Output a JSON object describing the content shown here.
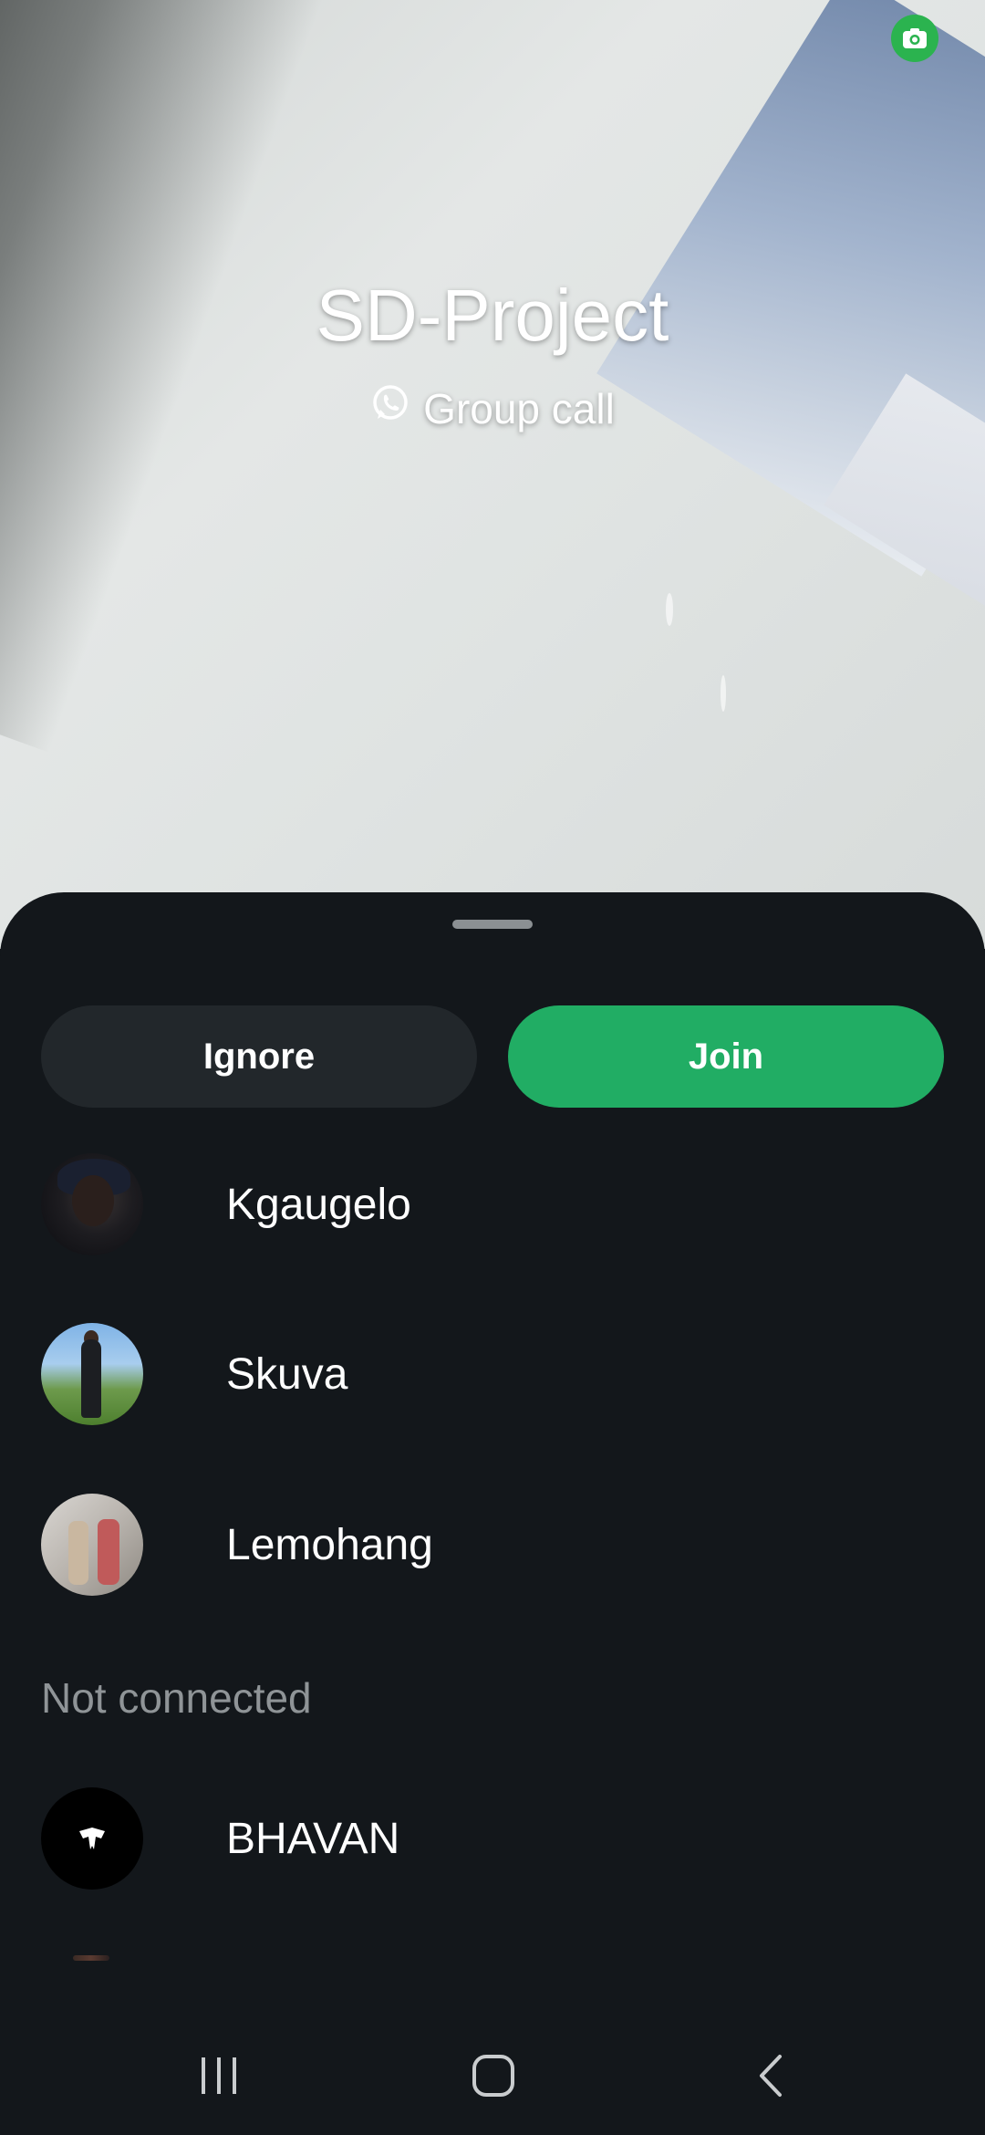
{
  "call": {
    "title": "SD-Project",
    "subtitle": "Group call",
    "subtitle_icon": "whatsapp-icon",
    "camera_icon": "camera-icon"
  },
  "actions": {
    "ignore_label": "Ignore",
    "join_label": "Join"
  },
  "participants": [
    {
      "name": "Kgaugelo",
      "avatar": "photo"
    },
    {
      "name": "Skuva",
      "avatar": "photo"
    },
    {
      "name": "Lemohang",
      "avatar": "photo"
    }
  ],
  "not_connected": {
    "label": "Not connected",
    "participants": [
      {
        "name": "BHAVAN",
        "avatar": "logo"
      }
    ]
  },
  "navbar": {
    "recents_icon": "recents-icon",
    "home_icon": "home-icon",
    "back_icon": "back-icon"
  },
  "colors": {
    "sheet_bg": "#13171b",
    "join_green": "#21ad64",
    "ignore_bg": "#22272b",
    "camera_badge": "#2bb34f",
    "muted_text": "#8f9497"
  }
}
